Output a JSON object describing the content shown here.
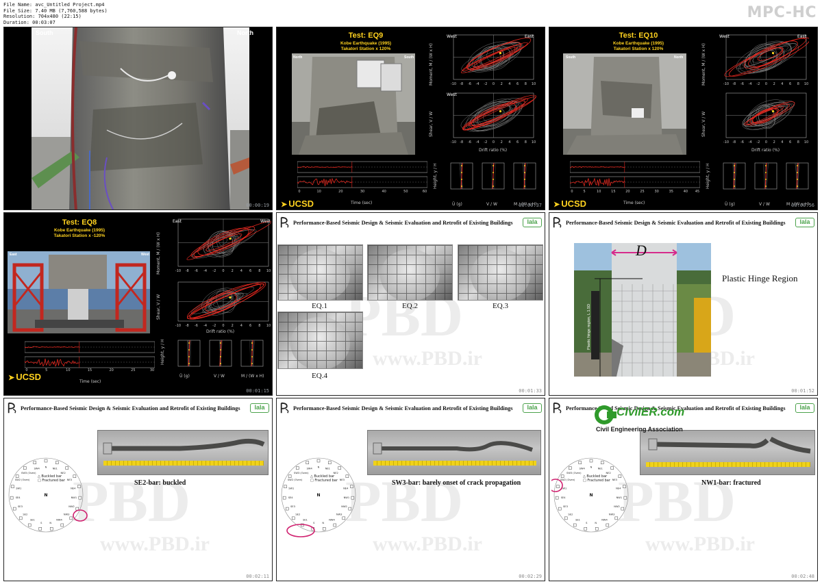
{
  "file_info": {
    "name": "File Name: avc_Untitled Project.mp4",
    "size": "File Size: 7.40 MB (7,760,588 bytes)",
    "resolution": "Resolution: 704x480 (22:15)",
    "duration": "Duration: 00:03:07"
  },
  "player_logo": "MPC-HC",
  "thumbs": {
    "t1": {
      "timestamp": "00:00:19",
      "south": "South",
      "north": "North"
    },
    "t2": {
      "timestamp": "00:00:37",
      "title": "Test: EQ9",
      "sub1": "Kobe Earthquake (1995)",
      "sub2": "Takatori Station x 120%",
      "north": "North",
      "south": "South",
      "west": "West",
      "east": "East",
      "ylabel_m": "Moment, M / (W x H)",
      "ylabel_v": "Shear, V / W",
      "xlabel": "Drift ratio (%)",
      "xlabel_time": "Time (sec)",
      "height": "Height, y / H",
      "ug_label": "Ü (g)",
      "vw_label": "V / W",
      "mw_label": "M / (W x H)",
      "ticks_drift": [
        "-10",
        "-8",
        "-6",
        "-4",
        "-2",
        "0",
        "2",
        "4",
        "6",
        "8",
        "10"
      ],
      "ticks_time": [
        "0",
        "10",
        "20",
        "30",
        "40",
        "50",
        "60"
      ],
      "ticks_m": [
        "0.25",
        "0",
        "-0.25"
      ],
      "ticks_v": [
        "0.2",
        "0",
        "-0.2",
        "-0.4"
      ],
      "ticks_h": [
        "1",
        "0.75",
        "0.5",
        "0.25"
      ]
    },
    "t3": {
      "timestamp": "00:00:56",
      "title": "Test: EQ10",
      "sub1": "Kobe Earthquake (1995)",
      "sub2": "Takatori Station x 120%",
      "south": "South",
      "north": "North",
      "west": "West",
      "east": "East",
      "ylabel_m": "Moment, M / (W x H)",
      "ylabel_v": "Shear, V / W",
      "xlabel": "Drift ratio (%)",
      "xlabel_time": "Time (sec)",
      "height": "Height, y / H",
      "ug_label": "Ü (g)",
      "vw_label": "V / W",
      "mw_label": "M / (W x H)",
      "ticks_time": [
        "0",
        "5",
        "10",
        "15",
        "20",
        "25",
        "30",
        "35",
        "40",
        "45"
      ]
    },
    "t4": {
      "timestamp": "00:01:15",
      "title": "Test: EQ8",
      "sub1": "Kobe Earthquake (1995)",
      "sub2": "Takatori Station x -120%",
      "east": "East",
      "west": "West",
      "ylabel_m": "Moment, M / (W x H)",
      "ylabel_v": "Shear, V / W",
      "xlabel": "Drift ratio (%)",
      "xlabel_time": "Time (sec)",
      "height": "Height, y / H",
      "ug_label": "Ü (g)",
      "vw_label": "V / W",
      "mw_label": "M / (W x H)",
      "ticks_time": [
        "0",
        "5",
        "10",
        "15",
        "20",
        "25",
        "30"
      ]
    },
    "t5": {
      "timestamp": "00:01:33",
      "eq1": "EQ.1",
      "eq2": "EQ.2",
      "eq3": "EQ.3",
      "eq4": "EQ.4"
    },
    "t6": {
      "timestamp": "00:01:52",
      "d": "D",
      "region": "Plastic Hinge Region",
      "side": "Plastic hinge region, L",
      "side2": "1.5D"
    },
    "t7": {
      "timestamp": "00:02:11",
      "caption": "SE2-bar: buckled"
    },
    "t8": {
      "timestamp": "00:02:29",
      "caption": "SW3-bar: barely onset of crack propagation"
    },
    "t9": {
      "timestamp": "00:02:48",
      "caption": "NW1-bar: fractured"
    }
  },
  "slide_header": {
    "title": "Performance-Based Seismic Design & Seismic Evaluation and Retrofit of Existing Buildings",
    "logo": "lala"
  },
  "watermark": {
    "top": "PBD",
    "bottom": "www.PBD.ir"
  },
  "bar_diagram": {
    "legend_buckled": "Buckled bar",
    "legend_fractured": "Fractured bar",
    "north": "N",
    "labels": [
      "N",
      "NE1",
      "NE2",
      "NE3",
      "NE4",
      "NW1",
      "NW2",
      "NW3",
      "NW4",
      "N",
      "S",
      "SE1",
      "SE2",
      "SE3",
      "SE4",
      "SW1",
      "SW2 (Oven)",
      "SW3 (Oven)",
      "SW4"
    ]
  },
  "civil_watermark": {
    "title": "CivilER.com",
    "sub": "Civil Engineering Association"
  }
}
